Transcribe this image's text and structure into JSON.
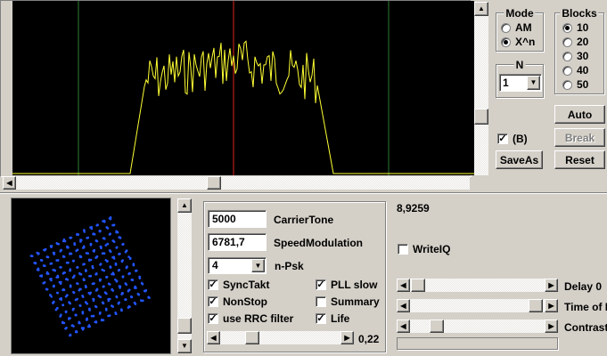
{
  "spectrum": {
    "colors": {
      "background": "#000000",
      "trace": "#ffff33",
      "center_line": "#e02020",
      "side_lines": "#2e7d32"
    }
  },
  "mode": {
    "title": "Mode",
    "options": [
      {
        "label": "AM",
        "selected": false
      },
      {
        "label": "X^n",
        "selected": true
      }
    ]
  },
  "n": {
    "title": "N",
    "value": "1"
  },
  "blocks": {
    "title": "Blocks",
    "options": [
      {
        "label": "10",
        "selected": true
      },
      {
        "label": "20",
        "selected": false
      },
      {
        "label": "30",
        "selected": false
      },
      {
        "label": "40",
        "selected": false
      },
      {
        "label": "50",
        "selected": false
      }
    ]
  },
  "buttons": {
    "auto": "Auto",
    "break": "Break",
    "save_as": "SaveAs",
    "reset": "Reset"
  },
  "b_check": {
    "label": "(B)",
    "checked": true
  },
  "constellation": {
    "background": "#000000",
    "dot_color": "#2255ff"
  },
  "params": {
    "carrier_tone": {
      "value": "5000",
      "label": "CarrierTone"
    },
    "speed_modulation": {
      "value": "6781,7",
      "label": "SpeedModulation"
    },
    "npsk": {
      "value": "4",
      "label": "n-Psk"
    }
  },
  "checks": {
    "sync_takt": {
      "label": "SyncTakt",
      "checked": true
    },
    "non_stop": {
      "label": "NonStop",
      "checked": true
    },
    "use_rrc_filter": {
      "label": "use RRC filter",
      "checked": true
    },
    "pll_slow": {
      "label": "PLL slow",
      "checked": true
    },
    "summary": {
      "label": "Summary",
      "checked": false
    },
    "life": {
      "label": "Life",
      "checked": true
    }
  },
  "rrc_slider": {
    "value": "0,22"
  },
  "readout": "8,9259",
  "write_iq": {
    "label": "WriteIQ",
    "checked": false
  },
  "sliders": {
    "delay": "Delay  0",
    "time_of": "Time of I",
    "contrast": "Contrast"
  }
}
